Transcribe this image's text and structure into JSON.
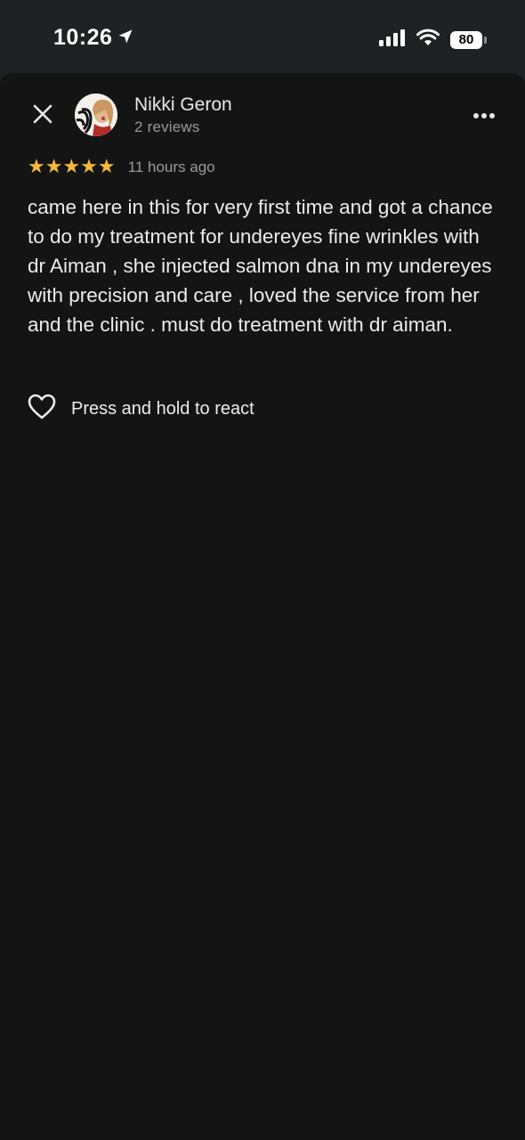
{
  "status_bar": {
    "time": "10:26",
    "battery": "80",
    "icons": [
      "location-arrow-icon",
      "cellular-signal-icon",
      "wifi-icon",
      "battery-icon"
    ]
  },
  "review": {
    "author_name": "Nikki Geron",
    "author_reviews": "2 reviews",
    "rating": 5,
    "stars": "★★★★★",
    "time": "11 hours ago",
    "text": "came here in this for very first time and got a chance to do my treatment for undereyes fine wrinkles with dr Aiman , she injected salmon dna in my undereyes with precision and care , loved the service from her and the clinic . must do treatment with dr aiman."
  },
  "actions": {
    "react_label": "Press and hold to react"
  },
  "colors": {
    "background": "#141414",
    "header_background": "#202125",
    "star": "#f6b93b",
    "text": "#ececec",
    "muted": "#9a9a9a"
  }
}
